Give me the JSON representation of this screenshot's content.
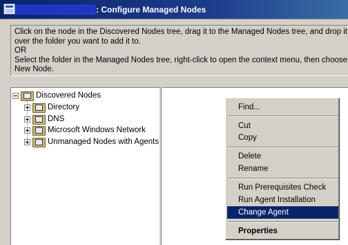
{
  "window": {
    "title": ": Configure Managed Nodes"
  },
  "instructions": {
    "line1": "Click on the node in the Discovered Nodes tree, drag it to the Managed Nodes tree, and drop it",
    "line2": "over the folder you want to add it to.",
    "line3": "OR",
    "line4": "Select the folder in the Managed Nodes tree, right-click to open the context menu, then choose",
    "line5": "New Node."
  },
  "tree": {
    "root": {
      "label": "Discovered Nodes",
      "expanded": true,
      "icon": "node-folder-icon"
    },
    "children": [
      {
        "label": "Directory",
        "icon": "node-folder-icon"
      },
      {
        "label": "DNS",
        "icon": "node-folder-icon"
      },
      {
        "label": "Microsoft Windows Network",
        "icon": "node-folder-icon"
      },
      {
        "label": "Unmanaged Nodes with Agents",
        "icon": "node-folder-icon"
      }
    ]
  },
  "context_menu": {
    "items": [
      {
        "label": "Find...",
        "highlighted": false
      },
      {
        "label": "Cut",
        "highlighted": false
      },
      {
        "label": "Copy",
        "highlighted": false
      },
      {
        "label": "Delete",
        "highlighted": false
      },
      {
        "label": "Rename",
        "highlighted": false
      },
      {
        "label": "Run Prerequisites Check",
        "highlighted": false
      },
      {
        "label": "Run Agent Installation",
        "highlighted": false
      },
      {
        "label": "Change Agent",
        "highlighted": true
      },
      {
        "label": "Properties",
        "highlighted": false,
        "bold": true
      }
    ]
  },
  "colors": {
    "titlebar": "#0a246a",
    "highlight": "#0a246a",
    "face": "#d4d0c8",
    "redaction": "#1e36c8"
  }
}
